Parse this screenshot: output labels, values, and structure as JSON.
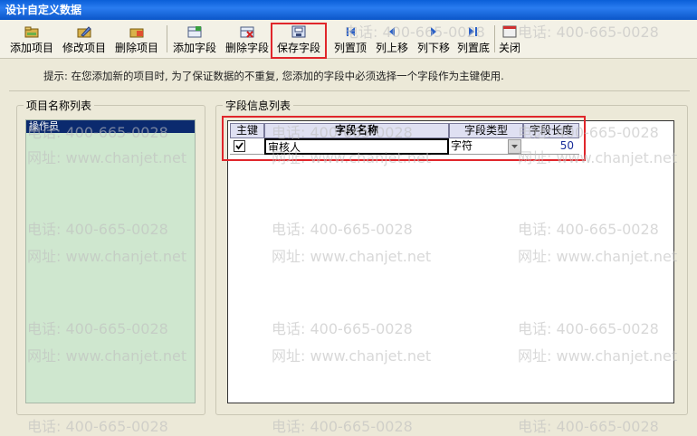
{
  "window": {
    "title": "设计自定义数据"
  },
  "toolbar": {
    "buttons": [
      {
        "label": "添加项目"
      },
      {
        "label": "修改项目"
      },
      {
        "label": "删除项目"
      },
      {
        "label": "添加字段"
      },
      {
        "label": "删除字段"
      },
      {
        "label": "保存字段"
      },
      {
        "label": "列置顶"
      },
      {
        "label": "列上移"
      },
      {
        "label": "列下移"
      },
      {
        "label": "列置底"
      },
      {
        "label": "关闭"
      }
    ]
  },
  "hint": "提示: 在您添加新的项目时, 为了保证数据的不重复, 您添加的字段中必须选择一个字段作为主键使用.",
  "project_list": {
    "title": "项目名称列表",
    "items": [
      "操作员"
    ]
  },
  "field_grid": {
    "title": "字段信息列表",
    "columns": [
      "主键",
      "字段名称",
      "字段类型",
      "字段长度"
    ],
    "rows": [
      {
        "primary_key": true,
        "name": "审核人",
        "type": "字符",
        "length": "50"
      }
    ]
  },
  "watermark": {
    "phone": "电话: 400-665-0028",
    "site": "网址: www.chanjet.net"
  },
  "colors": {
    "highlight": "#e0262b",
    "list_bg": "#cfe7cf",
    "selected": "#0b2a6e"
  }
}
